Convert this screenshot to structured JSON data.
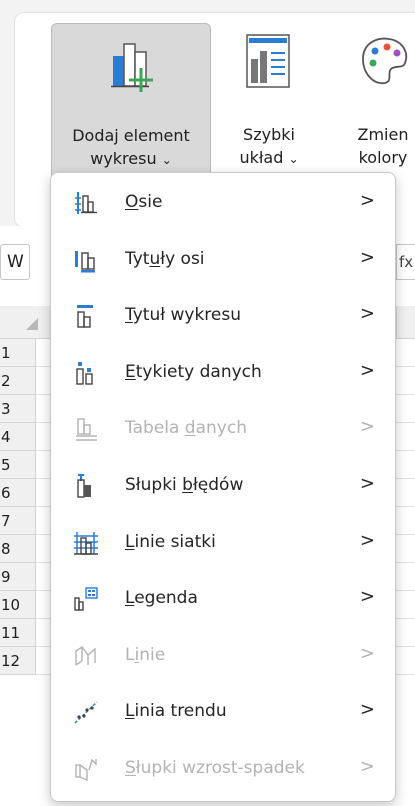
{
  "ribbon": {
    "add_element": {
      "line1": "Dodaj element",
      "line2": "wykresu",
      "chevron": "⌄"
    },
    "quick_layout": {
      "line1": "Szybki",
      "line2": "układ",
      "chevron": "⌄"
    },
    "change_colors": {
      "line1": "Zmien",
      "line2": "kolory"
    }
  },
  "sheet": {
    "namebox_fragment": "W",
    "formula_fragment": "fx",
    "rows": [
      "1",
      "2",
      "3",
      "4",
      "5",
      "6",
      "7",
      "8",
      "9",
      "10",
      "11",
      "12"
    ]
  },
  "menu": {
    "items": [
      {
        "pre": "",
        "ul": "O",
        "post": "sie",
        "disabled": false,
        "arrow": ">",
        "icon": "axes-icon"
      },
      {
        "pre": "Tyt",
        "ul": "u",
        "post": "ły osi",
        "disabled": false,
        "arrow": ">",
        "icon": "axis-titles-icon"
      },
      {
        "pre": "",
        "ul": "T",
        "post": "ytuł wykresu",
        "disabled": false,
        "arrow": ">",
        "icon": "chart-title-icon"
      },
      {
        "pre": "",
        "ul": "E",
        "post": "tykiety danych",
        "disabled": false,
        "arrow": ">",
        "icon": "data-labels-icon"
      },
      {
        "pre": "Tabela ",
        "ul": "d",
        "post": "anych",
        "disabled": true,
        "arrow": ">",
        "icon": "data-table-icon"
      },
      {
        "pre": "Słupki ",
        "ul": "b",
        "post": "łędów",
        "disabled": false,
        "arrow": ">",
        "icon": "error-bars-icon"
      },
      {
        "pre": "",
        "ul": "L",
        "post": "inie siatki",
        "disabled": false,
        "arrow": ">",
        "icon": "gridlines-icon"
      },
      {
        "pre": "",
        "ul": "L",
        "post": "egenda",
        "disabled": false,
        "arrow": ">",
        "icon": "legend-icon"
      },
      {
        "pre": "L",
        "ul": "i",
        "post": "nie",
        "disabled": true,
        "arrow": ">",
        "icon": "lines-icon"
      },
      {
        "pre": "",
        "ul": "L",
        "post": "inia trendu",
        "disabled": false,
        "arrow": ">",
        "icon": "trendline-icon"
      },
      {
        "pre": "",
        "ul": "S",
        "post": "łupki wzrost-spadek",
        "disabled": true,
        "arrow": ">",
        "icon": "up-down-bars-icon"
      }
    ]
  },
  "colors": {
    "accent_blue": "#2b7cd3",
    "accent_green": "#3aa757",
    "disabled_text": "#b3b3b3"
  }
}
